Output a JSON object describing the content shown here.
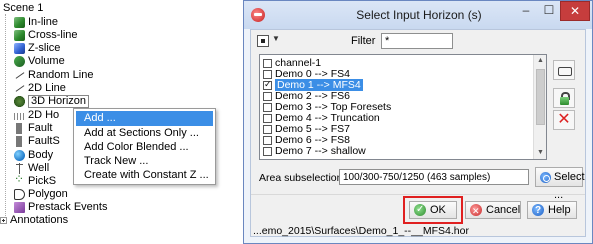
{
  "tree": {
    "items": [
      {
        "label": "Scene 1",
        "icon": "none"
      },
      {
        "label": "In-line",
        "icon": "inline-cube-icon"
      },
      {
        "label": "Cross-line",
        "icon": "crossline-cube-icon"
      },
      {
        "label": "Z-slice",
        "icon": "zslice-cube-icon"
      },
      {
        "label": "Volume",
        "icon": "volume-icon"
      },
      {
        "label": "Random Line",
        "icon": "random-line-icon"
      },
      {
        "label": "2D Line",
        "icon": "2d-line-icon"
      },
      {
        "label": "3D Horizon",
        "icon": "3d-horizon-icon"
      },
      {
        "label": "2D Ho",
        "icon": "2d-horizon-icon"
      },
      {
        "label": "Fault",
        "icon": "fault-icon"
      },
      {
        "label": "FaultS",
        "icon": "fault-stick-icon"
      },
      {
        "label": "Body",
        "icon": "body-icon"
      },
      {
        "label": "Well",
        "icon": "well-icon"
      },
      {
        "label": "PickS",
        "icon": "pickset-icon"
      },
      {
        "label": "Polygon",
        "icon": "polygon-icon"
      },
      {
        "label": "Prestack Events",
        "icon": "prestack-icon"
      },
      {
        "label": "Annotations",
        "icon": "expand-icon"
      }
    ]
  },
  "context_menu": {
    "items": [
      {
        "label": "Add ..."
      },
      {
        "label": "Add at Sections Only ..."
      },
      {
        "label": "Add Color Blended ..."
      },
      {
        "label": "Track New ..."
      },
      {
        "label": "Create with Constant Z ..."
      }
    ]
  },
  "dialog": {
    "title": "Select Input Horizon (s)",
    "controls": {
      "minimize": "–",
      "maximize": "☐",
      "close": "✕"
    },
    "filter_label": "Filter",
    "filter_value": "*",
    "list_items": [
      {
        "label": "channel-1",
        "checkbox": false,
        "checked": false
      },
      {
        "label": "Demo 0 --> FS4",
        "checkbox": true,
        "checked": false
      },
      {
        "label": "Demo 1 --> MFS4",
        "checkbox": true,
        "checked": true
      },
      {
        "label": "Demo 2 --> FS6",
        "checkbox": true,
        "checked": false
      },
      {
        "label": "Demo 3  --> Top Foresets",
        "checkbox": true,
        "checked": false
      },
      {
        "label": "Demo 4 --> Truncation",
        "checkbox": true,
        "checked": false
      },
      {
        "label": "Demo 5 --> FS7",
        "checkbox": true,
        "checked": false
      },
      {
        "label": "Demo 6 --> FS8",
        "checkbox": true,
        "checked": false
      },
      {
        "label": "Demo 7 --> shallow",
        "checkbox": true,
        "checked": false
      }
    ],
    "area_label": "Area subselection",
    "area_value": "100/300-750/1250 (463 samples)",
    "select_button": "Select ...",
    "ok_button": "OK",
    "cancel_button": "Cancel",
    "help_button": "Help",
    "status_path": "...emo_2015\\Surfaces\\Demo_1_--__MFS4.hor"
  },
  "colors": {
    "accent": "#3b8ee6",
    "highlight_box": "#e02020",
    "title_bar": "#c9d9f0",
    "close_button": "#c63d3d"
  }
}
